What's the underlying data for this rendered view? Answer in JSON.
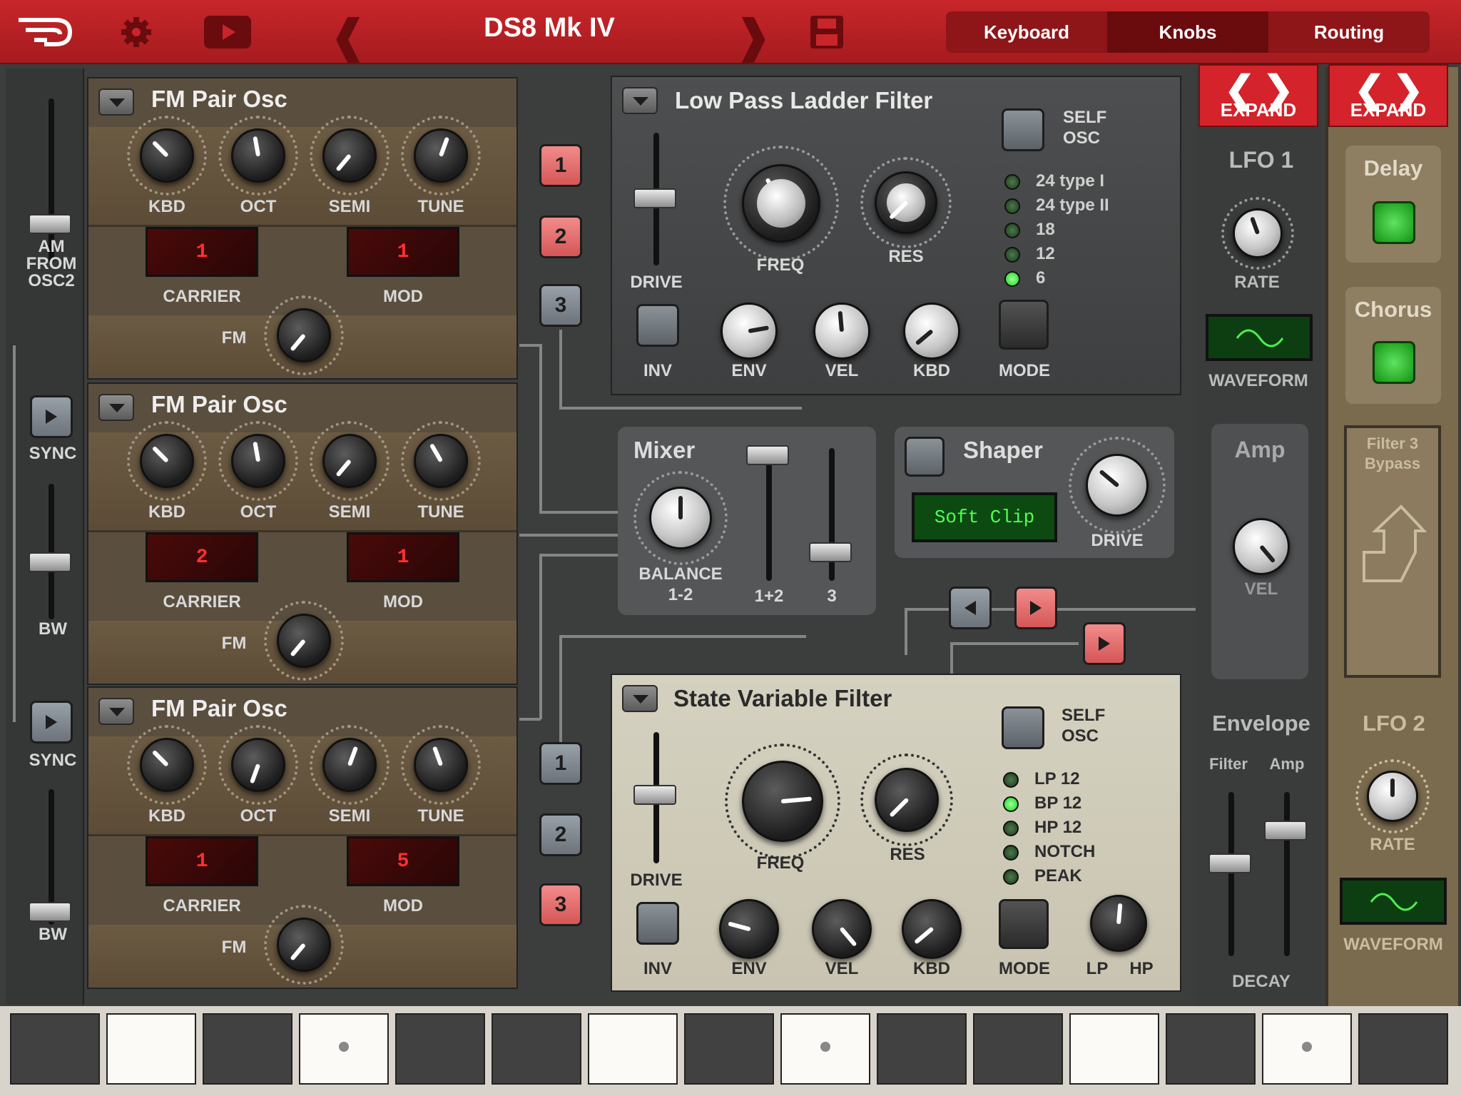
{
  "header": {
    "title": "DS8 Mk IV",
    "tabs": [
      "Keyboard",
      "Knobs",
      "Routing"
    ],
    "active_tab": "Knobs"
  },
  "osc_panels": [
    {
      "title": "FM Pair Osc",
      "knobs": [
        "KBD",
        "OCT",
        "SEMI",
        "TUNE"
      ],
      "carrier_value": "1",
      "mod_value": "1",
      "carrier_label": "CARRIER",
      "mod_label": "MOD",
      "fm_label": "FM"
    },
    {
      "title": "FM Pair Osc",
      "knobs": [
        "KBD",
        "OCT",
        "SEMI",
        "TUNE"
      ],
      "carrier_value": "2",
      "mod_value": "1",
      "carrier_label": "CARRIER",
      "mod_label": "MOD",
      "fm_label": "FM"
    },
    {
      "title": "FM Pair Osc",
      "knobs": [
        "KBD",
        "OCT",
        "SEMI",
        "TUNE"
      ],
      "carrier_value": "1",
      "mod_value": "5",
      "carrier_label": "CARRIER",
      "mod_label": "MOD",
      "fm_label": "FM"
    }
  ],
  "left_strip": {
    "am_label": "AM\nFROM\nOSC2",
    "sync_label": "SYNC",
    "bw_label": "BW"
  },
  "routing_buttons": {
    "top": [
      "1",
      "2",
      "3"
    ],
    "bottom": [
      "1",
      "2",
      "3"
    ]
  },
  "lp_filter": {
    "title": "Low Pass Ladder Filter",
    "self_osc": "SELF\nOSC",
    "types": [
      "24 type I",
      "24 type II",
      "18",
      "12",
      "6"
    ],
    "active_type": 4,
    "labels": {
      "freq": "FREQ",
      "res": "RES",
      "drive": "DRIVE",
      "inv": "INV",
      "env": "ENV",
      "vel": "VEL",
      "kbd": "KBD",
      "mode": "MODE"
    }
  },
  "mixer": {
    "title": "Mixer",
    "balance": "BALANCE\n1-2",
    "ch12": "1+2",
    "ch3": "3"
  },
  "shaper": {
    "title": "Shaper",
    "mode": "Soft Clip",
    "drive": "DRIVE"
  },
  "sv_filter": {
    "title": "State Variable Filter",
    "self_osc": "SELF\nOSC",
    "types": [
      "LP 12",
      "BP 12",
      "HP 12",
      "NOTCH",
      "PEAK"
    ],
    "active_type": 1,
    "labels": {
      "freq": "FREQ",
      "res": "RES",
      "drive": "DRIVE",
      "inv": "INV",
      "env": "ENV",
      "vel": "VEL",
      "kbd": "KBD",
      "mode": "MODE",
      "lp": "LP",
      "hp": "HP"
    }
  },
  "right": {
    "expand": "EXPAND",
    "lfo1": "LFO 1",
    "rate": "RATE",
    "waveform": "WAVEFORM",
    "amp": "Amp",
    "vel": "VEL",
    "envelope": "Envelope",
    "filter": "Filter",
    "amp_sub": "Amp",
    "decay": "DECAY"
  },
  "fx": {
    "delay": "Delay",
    "chorus": "Chorus",
    "filter3": "Filter 3\nBypass",
    "lfo2": "LFO 2",
    "rate": "RATE",
    "waveform": "WAVEFORM"
  }
}
